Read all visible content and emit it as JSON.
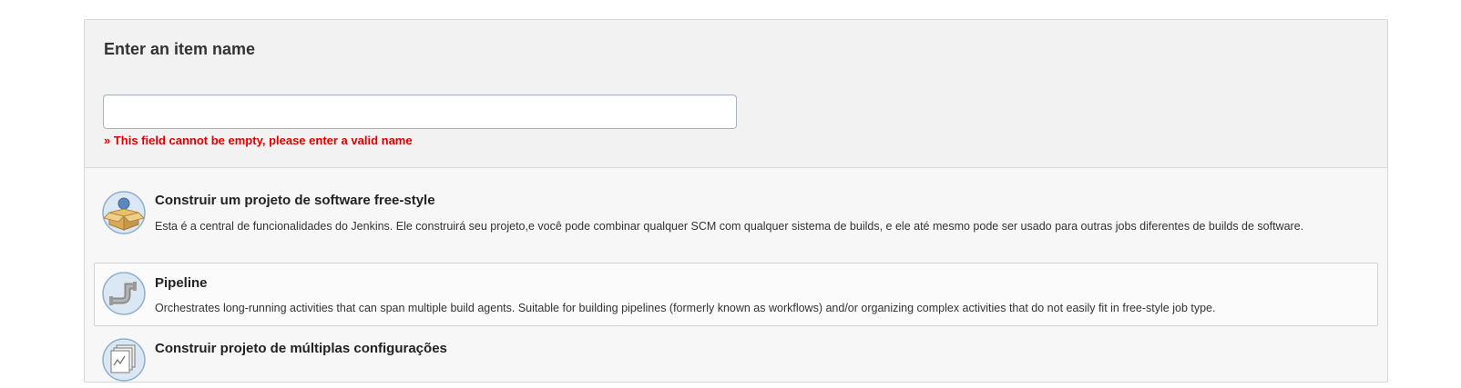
{
  "form": {
    "title": "Enter an item name",
    "name_value": "",
    "name_placeholder": "",
    "error": "» This field cannot be empty, please enter a valid name"
  },
  "item_types": [
    {
      "label": "Construir um projeto de software free-style",
      "description": "Esta é a central de funcionalidades do Jenkins. Ele construirá seu projeto,e você pode combinar qualquer SCM com qualquer sistema de builds, e ele até mesmo pode ser usado para outras jobs diferentes de builds de software.",
      "icon": "freestyle-project-icon"
    },
    {
      "label": "Pipeline",
      "description": "Orchestrates long-running activities that can span multiple build agents. Suitable for building pipelines (formerly known as workflows) and/or organizing complex activities that do not easily fit in free-style job type.",
      "icon": "pipeline-icon",
      "selected": true
    },
    {
      "label": "Construir projeto de múltiplas configurações",
      "description": "",
      "icon": "multi-configuration-project-icon"
    }
  ],
  "colors": {
    "error": "#e00000",
    "panel_background": "#f2f2f2",
    "icon_circle": "#c9dcec"
  }
}
